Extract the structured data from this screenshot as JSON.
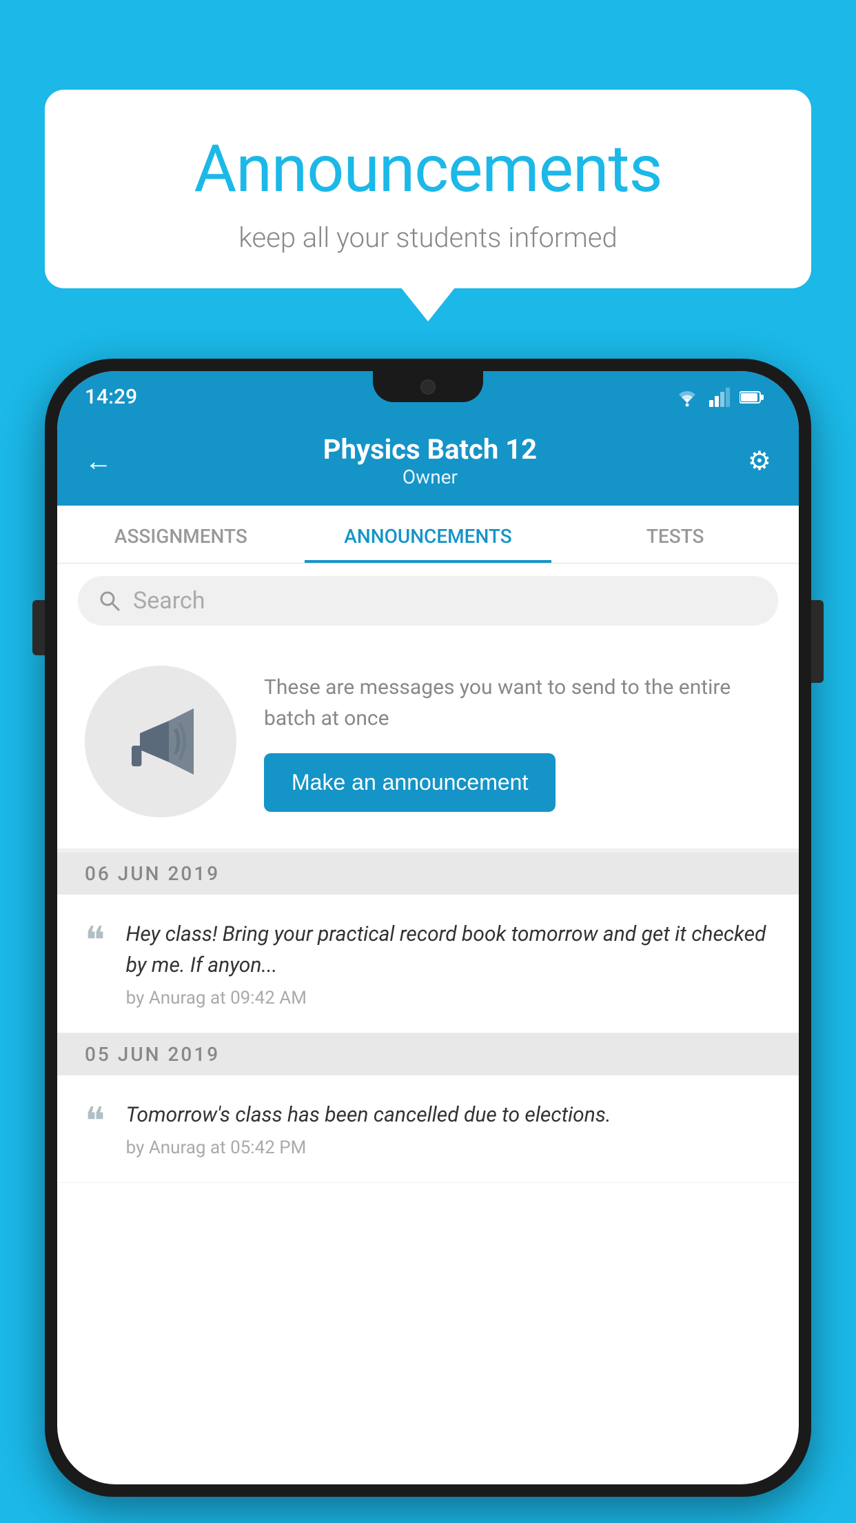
{
  "background": {
    "color": "#1bb8e8"
  },
  "speech_bubble": {
    "title": "Announcements",
    "subtitle": "keep all your students informed"
  },
  "phone": {
    "status_bar": {
      "time": "14:29"
    },
    "header": {
      "title": "Physics Batch 12",
      "subtitle": "Owner",
      "back_label": "←",
      "settings_label": "⚙"
    },
    "tabs": [
      {
        "label": "ASSIGNMENTS",
        "active": false
      },
      {
        "label": "ANNOUNCEMENTS",
        "active": true
      },
      {
        "label": "TESTS",
        "active": false
      }
    ],
    "search": {
      "placeholder": "Search"
    },
    "promo": {
      "description": "These are messages you want to send to the entire batch at once",
      "button_label": "Make an announcement"
    },
    "announcements": [
      {
        "date": "06  JUN  2019",
        "text": "Hey class! Bring your practical record book tomorrow and get it checked by me. If anyon...",
        "meta": "by Anurag at 09:42 AM"
      },
      {
        "date": "05  JUN  2019",
        "text": "Tomorrow's class has been cancelled due to elections.",
        "meta": "by Anurag at 05:42 PM"
      }
    ]
  }
}
